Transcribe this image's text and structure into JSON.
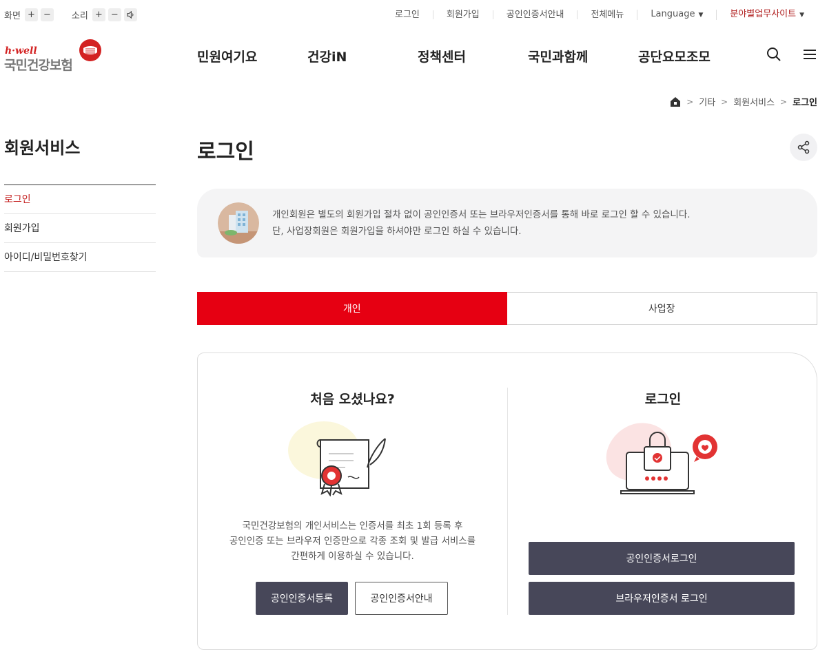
{
  "util": {
    "screen_label": "화면",
    "sound_label": "소리",
    "plus": "+",
    "minus": "−"
  },
  "toplinks": {
    "login": "로그인",
    "join": "회원가입",
    "cert_guide": "공인인증서안내",
    "all_menu": "전체메뉴",
    "language": "Language",
    "field_sites": "분야별업무사이트"
  },
  "logo": {
    "hwell": "h·well",
    "name": "국민건강보험"
  },
  "gnb": [
    "민원여기요",
    "건강iN",
    "정책센터",
    "국민과함께",
    "공단요모조모"
  ],
  "breadcrumb": [
    "기타",
    "회원서비스",
    "로그인"
  ],
  "sidebar": {
    "title": "회원서비스",
    "items": [
      "로그인",
      "회원가입",
      "아이디/비밀번호찾기"
    ]
  },
  "page": {
    "title": "로그인",
    "notice_line1": "개인회원은 별도의 회원가입 절차 없이 공인인증서 또는 브라우저인증서를 통해 바로 로그인 할 수 있습니다.",
    "notice_line2": "단, 사업장회원은 회원가입을 하셔야만 로그인 하실 수 있습니다."
  },
  "tabs": {
    "personal": "개인",
    "business": "사업장"
  },
  "panel": {
    "left_title": "처음 오셨나요?",
    "desc1": "국민건강보험의 개인서비스는 인증서를 최초 1회 등록 후",
    "desc2": "공인인증 또는 브라우저 인증만으로 각종 조회 및 발급 서비스를",
    "desc3": "간편하게 이용하실 수 있습니다.",
    "register_btn": "공인인증서등록",
    "guide_btn": "공인인증서안내",
    "right_title": "로그인",
    "cert_login_btn": "공인인증서로그인",
    "browser_login_btn": "브라우저인증서 로그인"
  },
  "colors": {
    "accent_red": "#e60012",
    "dark_button": "#474759"
  }
}
